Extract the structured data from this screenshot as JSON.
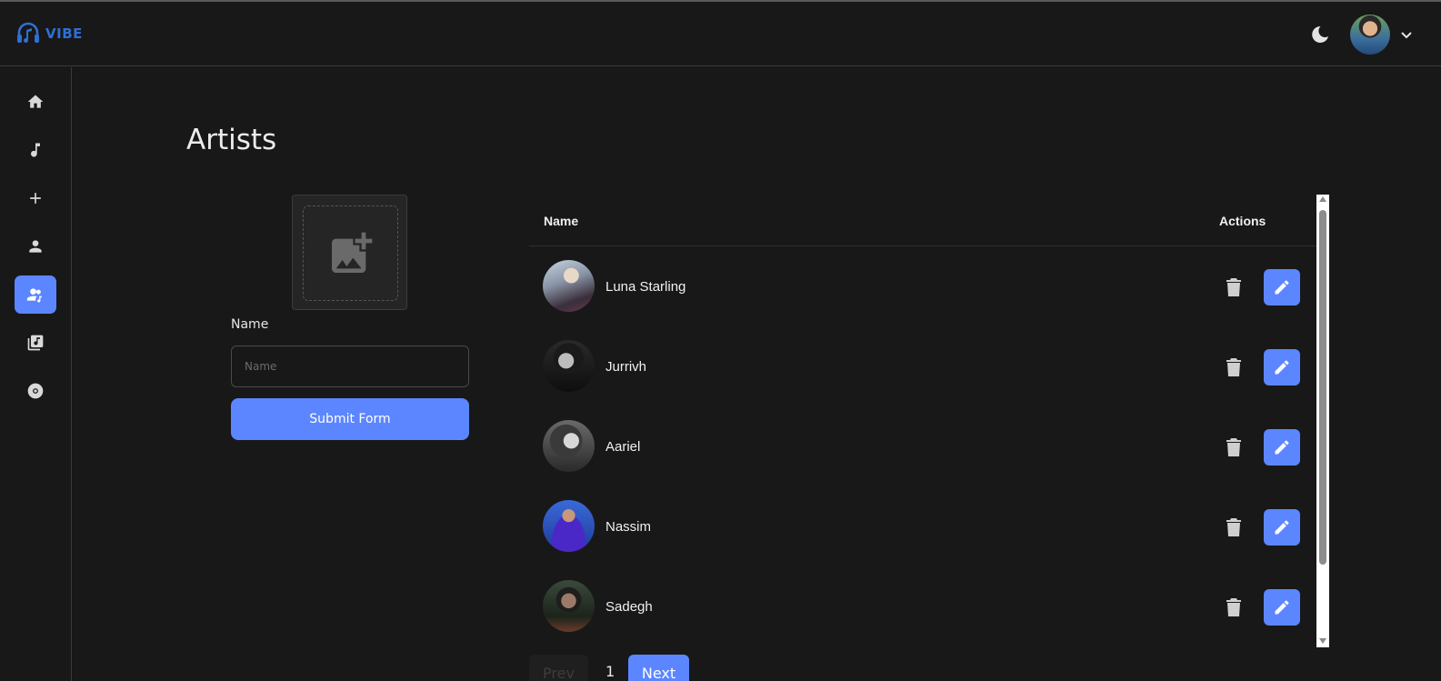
{
  "app": {
    "logo_text": "VIBE"
  },
  "colors": {
    "accent": "#5c86ff",
    "background": "#181818",
    "logo": "#2f6fd6"
  },
  "header": {
    "theme_icon": "moon-icon",
    "avatar_icon": "user-avatar",
    "caret_icon": "chevron-down-icon"
  },
  "sidebar": {
    "items": [
      {
        "icon": "home-icon",
        "active": false
      },
      {
        "icon": "music-note-icon",
        "active": false
      },
      {
        "icon": "plus-icon",
        "active": false
      },
      {
        "icon": "person-icon",
        "active": false
      },
      {
        "icon": "artists-icon",
        "active": true
      },
      {
        "icon": "library-music-icon",
        "active": false
      },
      {
        "icon": "album-icon",
        "active": false
      }
    ]
  },
  "page": {
    "title": "Artists"
  },
  "form": {
    "upload_icon": "add-photo-icon",
    "name_label": "Name",
    "name_placeholder": "Name",
    "name_value": "",
    "submit_label": "Submit Form"
  },
  "table": {
    "headers": {
      "name": "Name",
      "actions": "Actions"
    },
    "rows": [
      {
        "name": "Luna Starling"
      },
      {
        "name": "Jurrivh"
      },
      {
        "name": "Aariel"
      },
      {
        "name": "Nassim"
      },
      {
        "name": "Sadegh"
      }
    ]
  },
  "pagination": {
    "prev_label": "Prev",
    "current_page": "1",
    "next_label": "Next"
  }
}
